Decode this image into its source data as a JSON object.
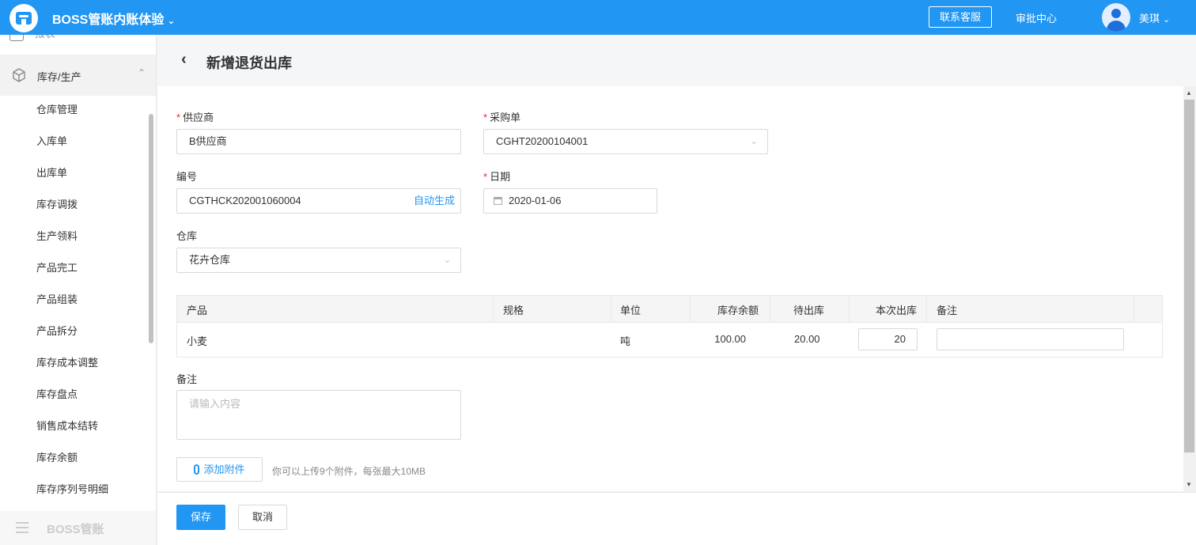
{
  "header": {
    "app_title": "BOSS管账内账体验",
    "contact_label": "联系客服",
    "approval_label": "审批中心",
    "user_name": "美琪",
    "brand_color": "#2196f3"
  },
  "sidebar": {
    "partial_item_label": "报表",
    "group_label": "库存/生产",
    "items": [
      "仓库管理",
      "入库单",
      "出库单",
      "库存调拨",
      "生产领料",
      "产品完工",
      "产品组装",
      "产品拆分",
      "库存成本调整",
      "库存盘点",
      "销售成本结转",
      "库存余额",
      "库存序列号明细"
    ],
    "footer_label": "BOSS管账"
  },
  "page": {
    "title": "新增退货出库"
  },
  "form": {
    "supplier": {
      "label": "供应商",
      "value": "B供应商"
    },
    "purchase_order": {
      "label": "采购单",
      "value": "CGHT20200104001"
    },
    "number": {
      "label": "编号",
      "value": "CGTHCK202001060004",
      "auto_label": "自动生成"
    },
    "date": {
      "label": "日期",
      "value": "2020-01-06"
    },
    "warehouse": {
      "label": "仓库",
      "value": "花卉仓库"
    },
    "remark": {
      "label": "备注",
      "placeholder": "请输入内容"
    },
    "attach_label": "添加附件",
    "attach_hint": "你可以上传9个附件，每张最大10MB"
  },
  "table": {
    "headers": {
      "product": "产品",
      "spec": "规格",
      "unit": "单位",
      "stock": "库存余额",
      "pending": "待出库",
      "this_out": "本次出库",
      "remark": "备注"
    },
    "rows": [
      {
        "product": "小麦",
        "spec": "",
        "unit": "吨",
        "stock": "100.00",
        "pending": "20.00",
        "this_out": "20",
        "remark": ""
      }
    ]
  },
  "footer": {
    "save_label": "保存",
    "cancel_label": "取消"
  }
}
